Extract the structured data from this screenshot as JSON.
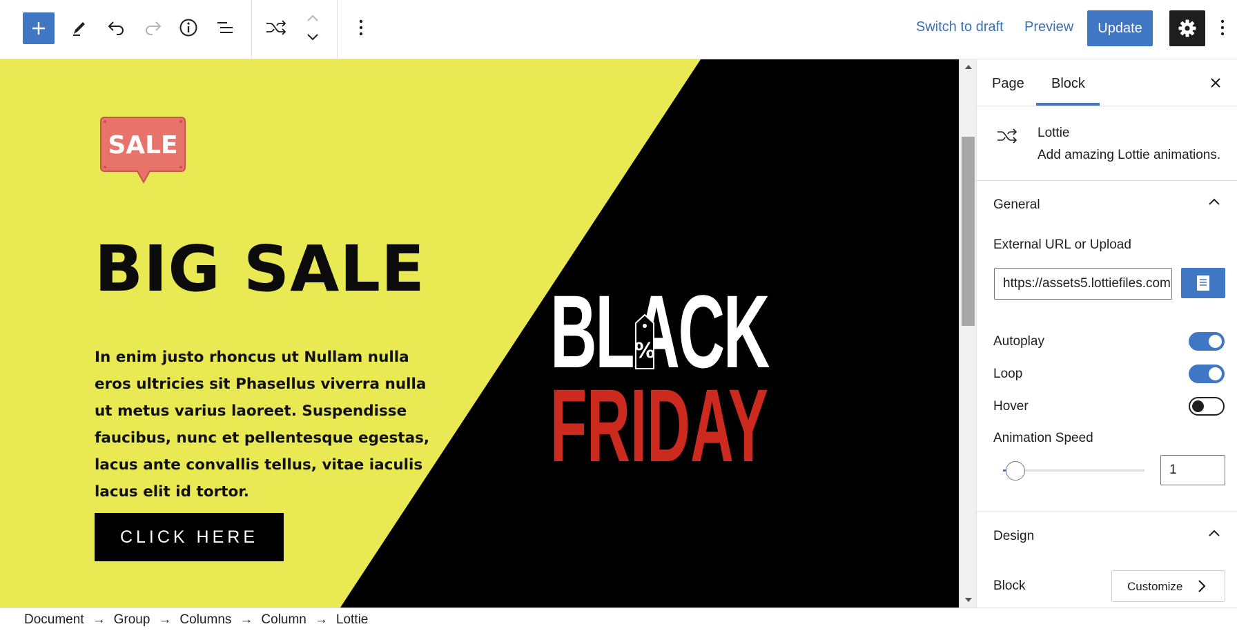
{
  "toolbar": {
    "switch_to_draft": "Switch to draft",
    "preview": "Preview",
    "update": "Update",
    "icons": [
      "plus-icon",
      "pencil-icon",
      "undo-icon",
      "redo-icon",
      "info-icon",
      "list-view-icon",
      "shuffle-icon",
      "chevron-up-icon",
      "chevron-down-icon",
      "more-vertical-icon",
      "gear-icon"
    ]
  },
  "canvas": {
    "badge_text": "SALE",
    "heading": "BIG SALE",
    "paragraph": "In enim justo rhoncus ut Nullam nulla eros ultricies sit Phasellus viverra nulla ut metus varius laoreet. Suspendisse faucibus, nunc et pellentesque egestas, lacus ante convallis tellus, vitae iaculis lacus elit id tortor.",
    "cta": "CLICK HERE",
    "logo_line1": "BLACK",
    "logo_line2": "FRIDAY",
    "logo_tag": "%",
    "colors": {
      "yellow": "#e9e953",
      "black": "#000000",
      "red": "#cc2a1f",
      "badge": "#e8736a"
    }
  },
  "sidebar": {
    "tabs": [
      {
        "label": "Page"
      },
      {
        "label": "Block"
      }
    ],
    "active_tab": "Block",
    "block": {
      "title": "Lottie",
      "description": "Add amazing Lottie animations."
    },
    "general": {
      "heading": "General",
      "url_label": "External URL or Upload",
      "url_value": "https://assets5.lottiefiles.com",
      "autoplay_label": "Autoplay",
      "autoplay": true,
      "loop_label": "Loop",
      "loop": true,
      "hover_label": "Hover",
      "hover": false,
      "speed_label": "Animation Speed",
      "speed_value": "1"
    },
    "design": {
      "heading": "Design",
      "block_label": "Block",
      "customize": "Customize"
    }
  },
  "breadcrumb": [
    "Document",
    "Group",
    "Columns",
    "Column",
    "Lottie"
  ],
  "accent": "#3f77c4"
}
